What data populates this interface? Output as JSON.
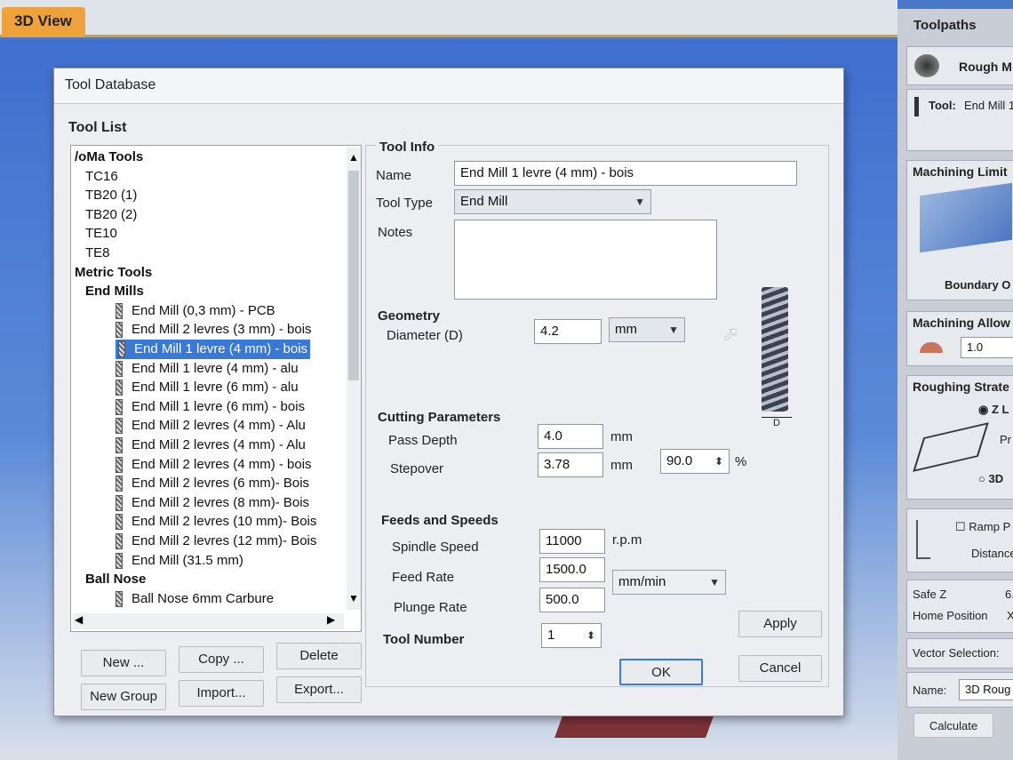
{
  "app": {
    "tab_3d": "3D View"
  },
  "right_panel": {
    "header": "Toolpaths",
    "rough_label": "Rough M",
    "tool_label": "Tool:",
    "tool_value": "End Mill 1",
    "machining_limit": "Machining Limit",
    "boundary": "Boundary O",
    "machining_allowance": "Machining Allow",
    "allowance_value": "1.0",
    "roughing_strategy": "Roughing Strate",
    "z_option": "Z L",
    "pr": "Pr",
    "option_3d": "3D",
    "ramp": "Ramp P",
    "distance": "Distance",
    "safe_z": "Safe Z",
    "safe_z_value": "6.",
    "home_position": "Home Position",
    "home_value": "X:",
    "vector_selection": "Vector Selection:",
    "name_label": "Name:",
    "name_value": "3D Roug",
    "calculate": "Calculate"
  },
  "dialog": {
    "title": "Tool Database",
    "tool_list_label": "Tool List",
    "tree": [
      {
        "text": "/oMa Tools",
        "level": 0,
        "bold": true
      },
      {
        "text": "TC16",
        "level": 1
      },
      {
        "text": "TB20 (1)",
        "level": 1
      },
      {
        "text": "TB20 (2)",
        "level": 1
      },
      {
        "text": "TE10",
        "level": 1
      },
      {
        "text": "TE8",
        "level": 1
      },
      {
        "text": "Metric Tools",
        "level": 0,
        "bold": true
      },
      {
        "text": "End Mills",
        "level": 1,
        "bold": true
      },
      {
        "text": "End Mill (0,3 mm) - PCB",
        "level": 2
      },
      {
        "text": "End Mill 2 levres (3 mm) - bois",
        "level": 2
      },
      {
        "text": "End Mill 1 levre (4 mm) - bois",
        "level": 2,
        "selected": true
      },
      {
        "text": "End Mill 1 levre (4 mm) - alu",
        "level": 2
      },
      {
        "text": "End Mill 1 levre (6 mm) - alu",
        "level": 2
      },
      {
        "text": "End Mill 1 levre (6 mm) - bois",
        "level": 2
      },
      {
        "text": "End Mill 2 levres (4 mm) - Alu",
        "level": 2
      },
      {
        "text": "End Mill 2 levres (4 mm) - Alu",
        "level": 2
      },
      {
        "text": "End Mill 2 levres (4 mm) - bois",
        "level": 2
      },
      {
        "text": "End Mill 2 levres (6 mm)- Bois",
        "level": 2
      },
      {
        "text": "End Mill 2 levres (8 mm)- Bois",
        "level": 2
      },
      {
        "text": "End Mill 2 levres (10 mm)- Bois",
        "level": 2
      },
      {
        "text": "End Mill 2 levres (12 mm)- Bois",
        "level": 2
      },
      {
        "text": "End Mill (31.5 mm)",
        "level": 2
      },
      {
        "text": "Ball Nose",
        "level": 1,
        "bold": true
      },
      {
        "text": "Ball Nose 6mm Carbure",
        "level": 2
      }
    ],
    "buttons": {
      "new": "New ...",
      "copy": "Copy ...",
      "delete": "Delete",
      "new_group": "New Group",
      "import": "Import...",
      "export": "Export...",
      "apply": "Apply",
      "ok": "OK",
      "cancel": "Cancel"
    },
    "tool_info": {
      "header": "Tool Info",
      "name_label": "Name",
      "name_value": "End Mill 1 levre (4 mm) - bois",
      "type_label": "Tool Type",
      "type_value": "End Mill",
      "notes_label": "Notes",
      "notes_value": ""
    },
    "geometry": {
      "header": "Geometry",
      "diameter_label": "Diameter (D)",
      "diameter_value": "4.2",
      "unit_value": "mm",
      "diagram_label": "D"
    },
    "cutting": {
      "header": "Cutting Parameters",
      "pass_depth_label": "Pass Depth",
      "pass_depth_value": "4.0",
      "pass_depth_unit": "mm",
      "stepover_label": "Stepover",
      "stepover_value": "3.78",
      "stepover_unit": "mm",
      "stepover_percent": "90.0",
      "percent_sign": "%"
    },
    "feeds": {
      "header": "Feeds and Speeds",
      "spindle_label": "Spindle Speed",
      "spindle_value": "11000",
      "spindle_unit": "r.p.m",
      "feed_label": "Feed Rate",
      "feed_value": "1500.0",
      "plunge_label": "Plunge Rate",
      "plunge_value": "500.0",
      "rate_unit": "mm/min"
    },
    "tool_number_label": "Tool Number",
    "tool_number_value": "1"
  }
}
